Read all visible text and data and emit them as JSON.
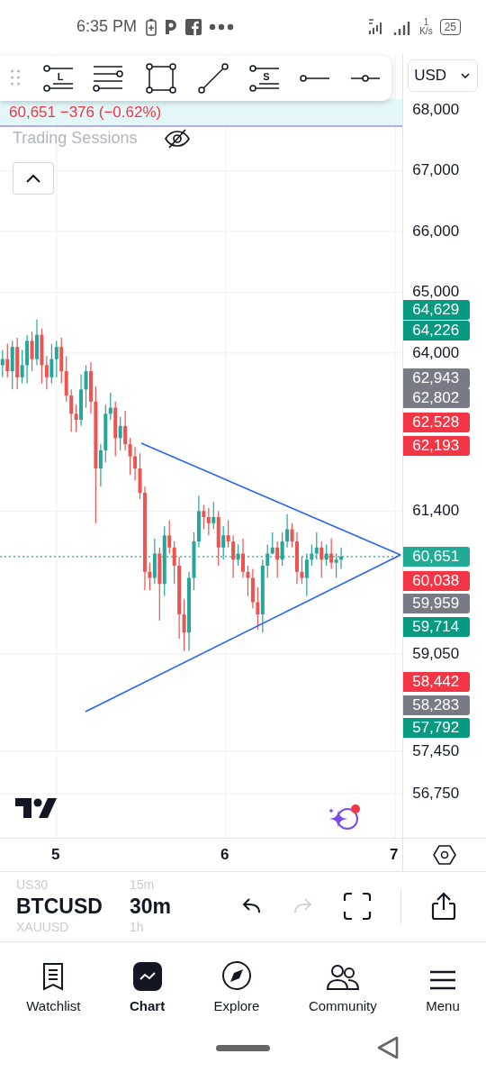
{
  "status_bar": {
    "time": "6:35 PM",
    "speed_value": "1",
    "speed_unit": "K/s",
    "battery": "25"
  },
  "toolbar": {
    "tools": [
      {
        "kind": "long",
        "letter": "L"
      },
      {
        "kind": "fib"
      },
      {
        "kind": "rectangle"
      },
      {
        "kind": "trend"
      },
      {
        "kind": "short",
        "letter": "S"
      },
      {
        "kind": "ray"
      },
      {
        "kind": "hline"
      }
    ]
  },
  "currency": "USD",
  "legend": {
    "quote": "60,651 −376 (−0.62%)",
    "indicator": "Trading Sessions",
    "indicator_hidden": true
  },
  "chart": {
    "chart_data": {
      "type": "candlestick",
      "x": [
        4.68,
        4.709,
        4.738,
        4.767,
        4.796,
        4.825,
        4.854,
        4.883,
        4.912,
        4.941,
        4.97,
        4.999,
        5.028,
        5.057,
        5.086,
        5.115,
        5.144,
        5.173,
        5.202,
        5.231,
        5.26,
        5.289,
        5.318,
        5.347,
        5.376,
        5.405,
        5.434,
        5.463,
        5.492,
        5.521,
        5.55,
        5.579,
        5.608,
        5.637,
        5.666,
        5.695,
        5.724,
        5.753,
        5.782,
        5.811,
        5.84,
        5.869,
        5.898,
        5.927,
        5.956,
        5.985,
        6.014,
        6.043,
        6.072,
        6.101,
        6.13,
        6.159,
        6.188,
        6.217,
        6.246,
        6.275,
        6.304,
        6.333,
        6.362,
        6.391,
        6.42,
        6.449,
        6.478,
        6.507,
        6.536,
        6.565,
        6.594,
        6.623,
        6.652,
        6.681
      ],
      "ohlc": [
        [
          63800,
          64050,
          63600,
          63900
        ],
        [
          63900,
          64150,
          63600,
          63700
        ],
        [
          63700,
          64200,
          63400,
          64100
        ],
        [
          64100,
          64250,
          63400,
          63600
        ],
        [
          63600,
          64050,
          63500,
          63800
        ],
        [
          63800,
          64300,
          63500,
          64200
        ],
        [
          64200,
          64350,
          63700,
          63900
        ],
        [
          63900,
          64550,
          63800,
          64300
        ],
        [
          64300,
          64400,
          63500,
          63800
        ],
        [
          63800,
          63950,
          63400,
          63600
        ],
        [
          63600,
          64150,
          63500,
          63900
        ],
        [
          63900,
          64200,
          63600,
          64100
        ],
        [
          64100,
          64250,
          63500,
          63700
        ],
        [
          63700,
          63950,
          63200,
          63300
        ],
        [
          63300,
          63400,
          62700,
          63000
        ],
        [
          63000,
          63150,
          62700,
          62900
        ],
        [
          62900,
          63650,
          62800,
          63400
        ],
        [
          63400,
          63800,
          63100,
          63700
        ],
        [
          63700,
          63850,
          63000,
          63200
        ],
        [
          63200,
          63450,
          61200,
          62100
        ],
        [
          62100,
          62500,
          61800,
          62400
        ],
        [
          62400,
          63150,
          62200,
          63000
        ],
        [
          63000,
          63350,
          62900,
          63100
        ],
        [
          63100,
          63200,
          62300,
          62600
        ],
        [
          62600,
          62950,
          62400,
          62800
        ],
        [
          62800,
          63050,
          62400,
          62500
        ],
        [
          62500,
          62600,
          62000,
          62300
        ],
        [
          62300,
          62450,
          61900,
          62100
        ],
        [
          62100,
          62350,
          61600,
          61700
        ],
        [
          61700,
          61800,
          60100,
          60400
        ],
        [
          60400,
          60550,
          60100,
          60300
        ],
        [
          60300,
          60950,
          60200,
          60700
        ],
        [
          60700,
          60800,
          59600,
          60200
        ],
        [
          60200,
          61150,
          60000,
          61000
        ],
        [
          61000,
          61250,
          60700,
          60800
        ],
        [
          60800,
          60900,
          60200,
          60500
        ],
        [
          60500,
          60650,
          59300,
          59700
        ],
        [
          59700,
          59950,
          59100,
          59400
        ],
        [
          59400,
          60400,
          59100,
          60300
        ],
        [
          60300,
          61050,
          60100,
          60900
        ],
        [
          60900,
          61650,
          60800,
          61400
        ],
        [
          61400,
          61500,
          61100,
          61300
        ],
        [
          61300,
          61450,
          61000,
          61200
        ],
        [
          61200,
          61550,
          61100,
          61300
        ],
        [
          61300,
          61400,
          60500,
          60800
        ],
        [
          60800,
          61150,
          60600,
          61000
        ],
        [
          61000,
          61250,
          60800,
          60900
        ],
        [
          60900,
          61000,
          60300,
          60600
        ],
        [
          60600,
          60850,
          60500,
          60700
        ],
        [
          60700,
          60950,
          60300,
          60400
        ],
        [
          60400,
          60500,
          60000,
          60300
        ],
        [
          60300,
          60450,
          59800,
          59900
        ],
        [
          59900,
          60150,
          59450,
          59700
        ],
        [
          59700,
          60600,
          59400,
          60500
        ],
        [
          60500,
          60850,
          60300,
          60700
        ],
        [
          60700,
          61050,
          60700,
          60800
        ],
        [
          60800,
          60900,
          60300,
          60600
        ],
        [
          60600,
          61050,
          60500,
          60900
        ],
        [
          60900,
          61350,
          60800,
          61100
        ],
        [
          61100,
          61200,
          60800,
          60900
        ],
        [
          60900,
          61050,
          60200,
          60400
        ],
        [
          60400,
          60650,
          60200,
          60300
        ],
        [
          60300,
          60700,
          60000,
          60600
        ],
        [
          60600,
          60850,
          60500,
          60700
        ],
        [
          60700,
          61050,
          60600,
          60800
        ],
        [
          60800,
          60900,
          60300,
          60600
        ],
        [
          60600,
          60850,
          60500,
          60700
        ],
        [
          60700,
          60950,
          60450,
          60550
        ],
        [
          60550,
          60700,
          60300,
          60600
        ],
        [
          60600,
          60800,
          60450,
          60651
        ]
      ],
      "grid": true,
      "ref_lines": [
        {
          "axis": "y",
          "value": 67733,
          "color": "#9e95e0"
        },
        {
          "axis": "y",
          "value": 60651,
          "color": "#22ab94"
        }
      ],
      "xlim": [
        4.665,
        7.537
      ],
      "ylim": [
        56024,
        68919
      ],
      "xticks": [
        {
          "value": 5,
          "label": "5"
        },
        {
          "value": 6,
          "label": "6"
        },
        {
          "value": 7,
          "label": "7"
        }
      ],
      "yticks": [
        {
          "value": 68000,
          "label": "68,000"
        },
        {
          "value": 67000,
          "label": "67,000"
        },
        {
          "value": 66000,
          "label": "66,000"
        },
        {
          "value": 65000,
          "label": "65,000"
        },
        {
          "value": 64000,
          "label": "64,000"
        },
        {
          "value": 61400,
          "label": "61,400"
        },
        {
          "value": 59050,
          "label": "59,050"
        },
        {
          "value": 57450,
          "label": "57,450"
        },
        {
          "value": 56750,
          "label": "56,750"
        }
      ]
    }
  },
  "price_tags": [
    {
      "value": "64,629",
      "color": "#089981"
    },
    {
      "value": "64,226",
      "color": "#089981"
    },
    {
      "value": "62,943",
      "color": "#787b86"
    },
    {
      "value": "62,802",
      "color": "#787b86"
    },
    {
      "value": "62,528",
      "color": "#f23645"
    },
    {
      "value": "62,193",
      "color": "#f23645"
    },
    {
      "value": "60,651",
      "color": "#22ab94"
    },
    {
      "value": "60,038",
      "color": "#f23645"
    },
    {
      "value": "59,959",
      "color": "#787b86"
    },
    {
      "value": "59,714",
      "color": "#089981"
    },
    {
      "value": "58,442",
      "color": "#f23645"
    },
    {
      "value": "58,283",
      "color": "#787b86"
    },
    {
      "value": "57,792",
      "color": "#089981"
    }
  ],
  "symbols": [
    {
      "symbol": "US30",
      "interval": "15m",
      "selected": false
    },
    {
      "symbol": "BTCUSD",
      "interval": "30m",
      "selected": true
    },
    {
      "symbol": "XAUUSD",
      "interval": "1h",
      "selected": false
    }
  ],
  "actions": [
    {
      "kind": "undo",
      "disabled": false
    },
    {
      "kind": "redo",
      "disabled": true
    },
    {
      "kind": "fullscreen"
    },
    {
      "kind": "share"
    }
  ],
  "nav": [
    {
      "kind": "watchlist",
      "label": "Watchlist",
      "selected": false
    },
    {
      "kind": "chart",
      "label": "Chart",
      "selected": true
    },
    {
      "kind": "explore",
      "label": "Explore",
      "selected": false
    },
    {
      "kind": "community",
      "label": "Community",
      "selected": false
    },
    {
      "kind": "menu",
      "label": "Menu",
      "selected": false
    }
  ]
}
